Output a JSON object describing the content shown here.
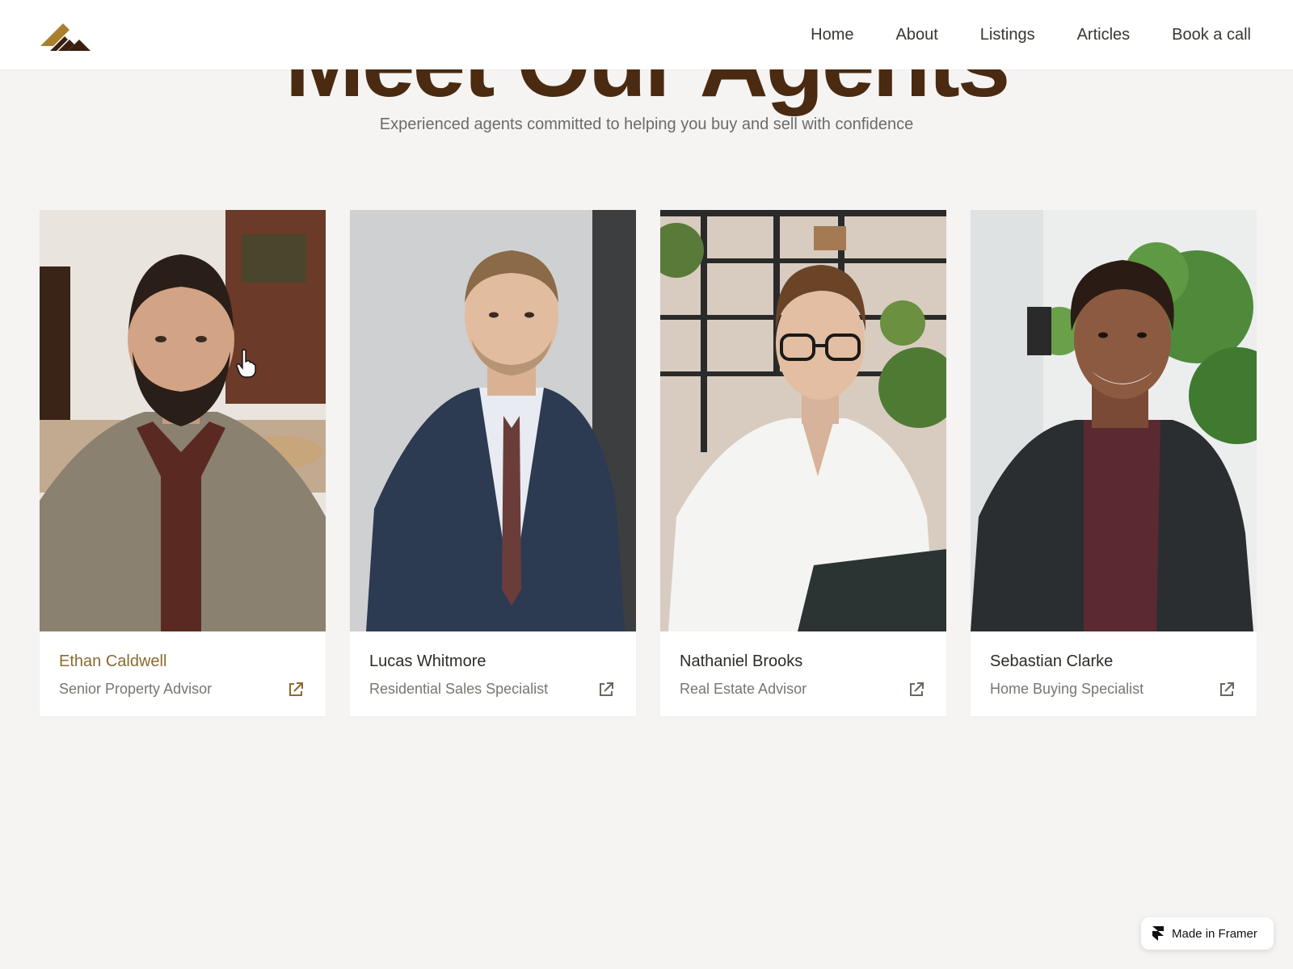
{
  "nav": {
    "links": [
      "Home",
      "About",
      "Listings",
      "Articles",
      "Book a call"
    ]
  },
  "section": {
    "title": "Meet Our Agents",
    "subtitle": "Experienced agents committed to helping you buy and sell with confidence"
  },
  "agents": [
    {
      "name": "Ethan Caldwell",
      "role": "Senior Property Advisor",
      "icon": "external-link-icon"
    },
    {
      "name": "Lucas Whitmore",
      "role": "Residential Sales Specialist",
      "icon": "external-link-icon"
    },
    {
      "name": "Nathaniel Brooks",
      "role": "Real Estate Advisor",
      "icon": "external-link-icon"
    },
    {
      "name": "Sebastian Clarke",
      "role": "Home Buying Specialist",
      "icon": "external-link-icon"
    }
  ],
  "badge": {
    "label": "Made in Framer",
    "icon": "framer-logo-icon"
  },
  "colors": {
    "brand_brown": "#4a2a10",
    "brand_gold": "#a97f2e",
    "active_name": "#8a6a2e",
    "background": "#f5f4f3"
  }
}
